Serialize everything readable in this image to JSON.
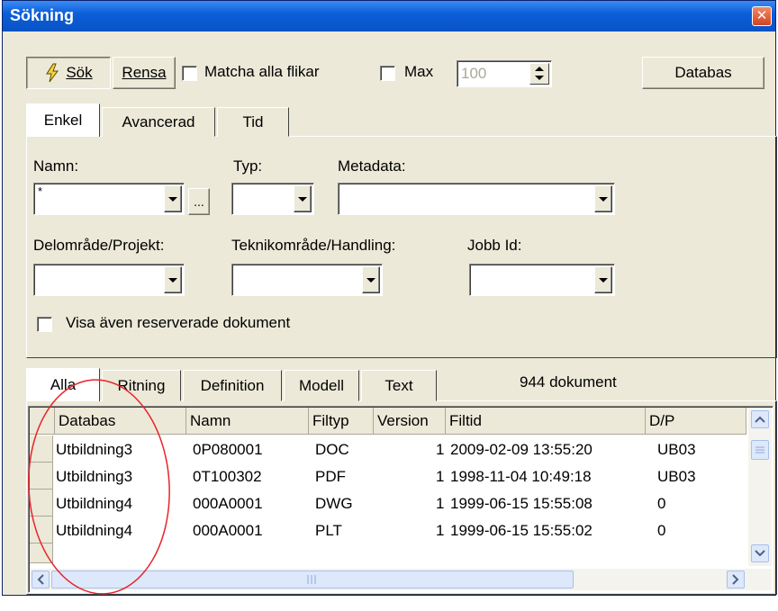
{
  "window": {
    "title": "Sökning",
    "close": "✕"
  },
  "toolbar": {
    "sok_label": "Sök",
    "rensa_label": "Rensa",
    "matcha_label": "Matcha alla flikar",
    "max_label": "Max",
    "max_value": "100",
    "databas_label": "Databas"
  },
  "search_tabs": [
    {
      "label": "Enkel"
    },
    {
      "label": "Avancerad"
    },
    {
      "label": "Tid"
    }
  ],
  "filters": {
    "namn_label": "Namn:",
    "namn_value": "*",
    "browse_label": "...",
    "typ_label": "Typ:",
    "metadata_label": "Metadata:",
    "delomrade_label": "Delområde/Projekt:",
    "teknik_label": "Teknikområde/Handling:",
    "jobb_label": "Jobb Id:",
    "visa_label": "Visa även reserverade dokument"
  },
  "result_tabs": [
    {
      "label": "Alla"
    },
    {
      "label": "Ritning"
    },
    {
      "label": "Definition"
    },
    {
      "label": "Modell"
    },
    {
      "label": "Text"
    }
  ],
  "doc_count": "944 dokument",
  "table": {
    "columns": [
      "Databas",
      "Namn",
      "Filtyp",
      "Version",
      "Filtid",
      "D/P"
    ],
    "rows": [
      [
        "Utbildning3",
        "0P080001",
        "DOC",
        "1",
        "2009-02-09 13:55:20",
        "UB03"
      ],
      [
        "Utbildning3",
        "0T100302",
        "PDF",
        "1",
        "1998-11-04 10:49:18",
        "UB03"
      ],
      [
        "Utbildning4",
        "000A0001",
        "DWG",
        "1",
        "1999-06-15 15:55:08",
        "0"
      ],
      [
        "Utbildning4",
        "000A0001",
        "PLT",
        "1",
        "1999-06-15 15:55:02",
        "0"
      ]
    ]
  },
  "colors": {
    "annotation": "#e8232a",
    "titlebar": "#0b5fd8",
    "face": "#ece9d8"
  }
}
